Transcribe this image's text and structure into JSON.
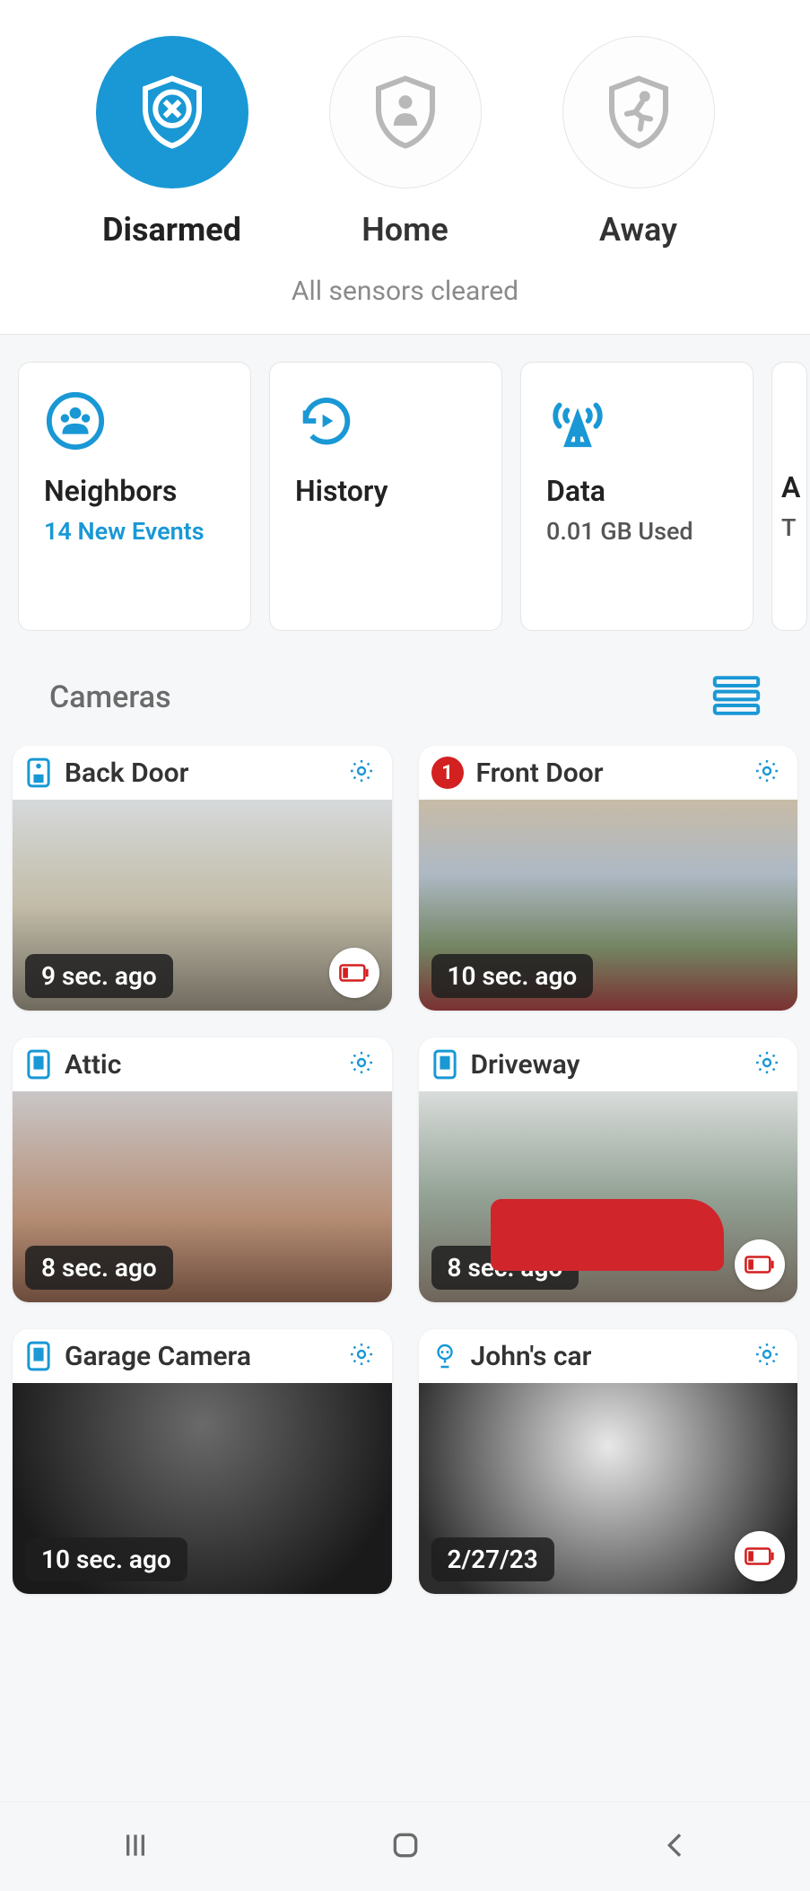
{
  "arm": {
    "modes": [
      {
        "id": "disarmed",
        "label": "Disarmed",
        "active": true
      },
      {
        "id": "home",
        "label": "Home",
        "active": false
      },
      {
        "id": "away",
        "label": "Away",
        "active": false
      }
    ],
    "status": "All sensors cleared"
  },
  "info_cards": [
    {
      "id": "neighbors",
      "title": "Neighbors",
      "sub": "14 New Events",
      "sub_muted": false
    },
    {
      "id": "history",
      "title": "History",
      "sub": "",
      "sub_muted": false
    },
    {
      "id": "data",
      "title": "Data",
      "sub": "0.01 GB Used",
      "sub_muted": true
    },
    {
      "id": "peek",
      "title": "A",
      "sub": "T",
      "sub_muted": true
    }
  ],
  "cameras": {
    "section_title": "Cameras",
    "items": [
      {
        "id": "back",
        "name": "Back Door",
        "time": "9 sec. ago",
        "battery_low": true,
        "badge": null,
        "icon": "cam-rect"
      },
      {
        "id": "front",
        "name": "Front Door",
        "time": "10 sec. ago",
        "battery_low": false,
        "badge": "1",
        "icon": "none"
      },
      {
        "id": "attic",
        "name": "Attic",
        "time": "8 sec. ago",
        "battery_low": false,
        "badge": null,
        "icon": "cam-rect"
      },
      {
        "id": "drive",
        "name": "Driveway",
        "time": "8 sec. ago",
        "battery_low": true,
        "badge": null,
        "icon": "cam-rect"
      },
      {
        "id": "garage",
        "name": "Garage Camera",
        "time": "10 sec. ago",
        "battery_low": false,
        "badge": null,
        "icon": "cam-rect"
      },
      {
        "id": "car",
        "name": "John's car",
        "time": "2/27/23",
        "battery_low": true,
        "badge": null,
        "icon": "cam-round"
      }
    ]
  }
}
